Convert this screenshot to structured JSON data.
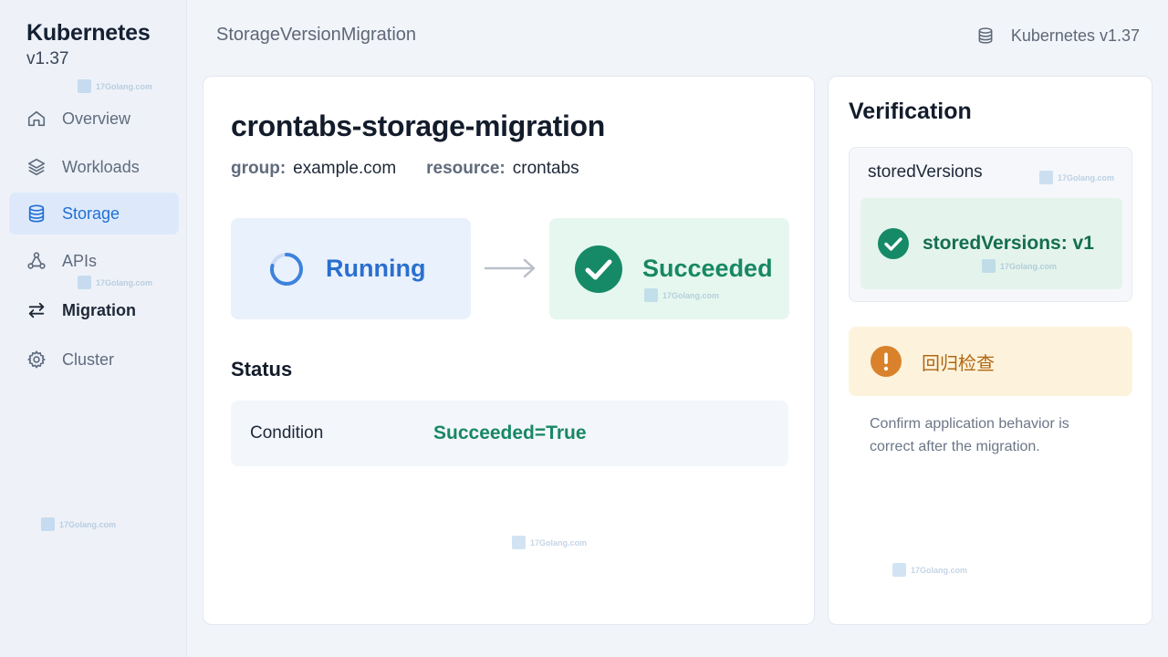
{
  "sidebar": {
    "brand_title": "Kubernetes",
    "brand_version": "v1.37",
    "items": [
      {
        "label": "Overview",
        "icon": "home-icon"
      },
      {
        "label": "Workloads",
        "icon": "layers-icon"
      },
      {
        "label": "Storage",
        "icon": "database-icon",
        "active": true
      },
      {
        "label": "APIs",
        "icon": "nodes-icon"
      },
      {
        "label": "Migration",
        "icon": "swap-arrows-icon"
      },
      {
        "label": "Cluster",
        "icon": "gear-icon"
      }
    ]
  },
  "topbar": {
    "title": "StorageVersionMigration",
    "version_label": "Kubernetes v1.37",
    "version_icon": "database-icon"
  },
  "main": {
    "resource_name": "crontabs-storage-migration",
    "group_key": "group:",
    "group_value": "example.com",
    "resource_key": "resource:",
    "resource_value": "crontabs",
    "phase_from": "Running",
    "phase_to": "Succeeded",
    "status_heading": "Status",
    "condition_label": "Condition",
    "condition_value": "Succeeded=True"
  },
  "verification": {
    "title": "Verification",
    "stored_versions_header": "storedVersions",
    "stored_versions_value": "storedVersions: v1",
    "warning_title": "回归检查",
    "warning_note": "Confirm application behavior is correct after the migration."
  },
  "watermark": "17Golang.com",
  "colors": {
    "accent_blue": "#1f6fd6",
    "success_green": "#178863",
    "warning_orange": "#d9822b"
  }
}
